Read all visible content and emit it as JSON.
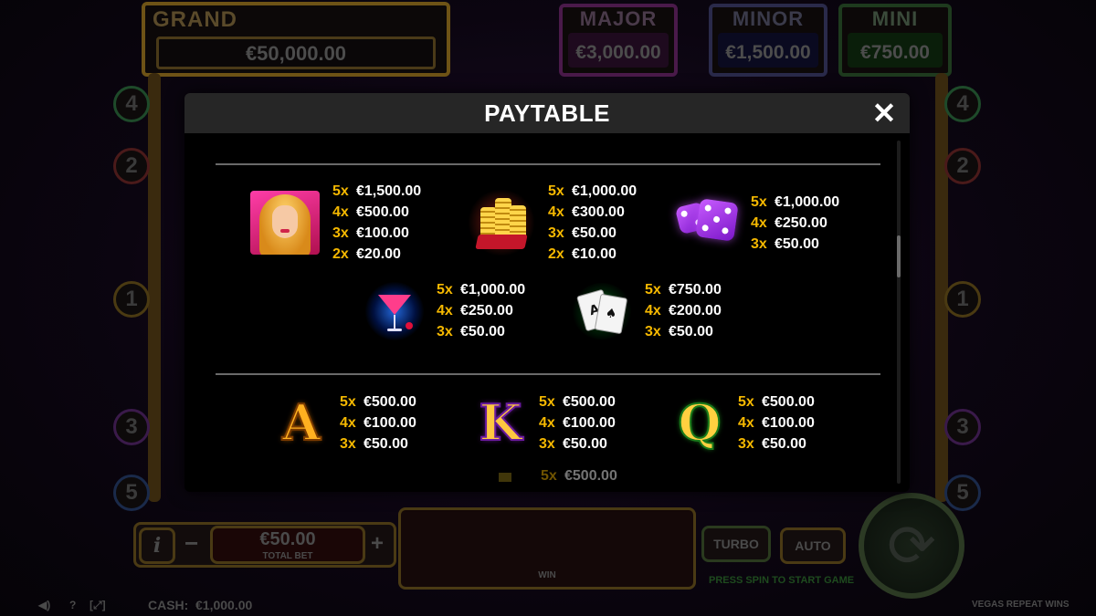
{
  "background": {
    "jackpots": {
      "grand": {
        "label": "GRAND",
        "value": "€50,000.00"
      },
      "major": {
        "label": "MAJOR",
        "value": "€3,000.00"
      },
      "minor": {
        "label": "MINOR",
        "value": "€1,500.00"
      },
      "mini": {
        "label": "MINI",
        "value": "€750.00"
      }
    },
    "line_numbers_left": [
      "4",
      "2",
      "1",
      "3",
      "5"
    ],
    "line_numbers_right": [
      "4",
      "2",
      "1",
      "3",
      "5"
    ],
    "total_bet": {
      "value": "€50.00",
      "label": "TOTAL BET"
    },
    "info_label": "i",
    "minus_label": "−",
    "plus_label": "+",
    "win_label": "WIN",
    "turbo_label": "TURBO",
    "auto_label": "AUTO",
    "prompt": "PRESS SPIN TO START GAME",
    "cash_label": "CASH:",
    "cash_value": "€1,000.00",
    "game_name": "VEGAS REPEAT WINS",
    "question_label": "?"
  },
  "modal": {
    "title": "PAYTABLE",
    "close_icon": "close-icon",
    "premium_symbols": [
      {
        "symbol": "blonde-woman",
        "pays": [
          {
            "mult": "5x",
            "amount": "€1,500.00"
          },
          {
            "mult": "4x",
            "amount": "€500.00"
          },
          {
            "mult": "3x",
            "amount": "€100.00"
          },
          {
            "mult": "2x",
            "amount": "€20.00"
          }
        ]
      },
      {
        "symbol": "gold-coins",
        "pays": [
          {
            "mult": "5x",
            "amount": "€1,000.00"
          },
          {
            "mult": "4x",
            "amount": "€300.00"
          },
          {
            "mult": "3x",
            "amount": "€50.00"
          },
          {
            "mult": "2x",
            "amount": "€10.00"
          }
        ]
      },
      {
        "symbol": "purple-dice",
        "pays": [
          {
            "mult": "5x",
            "amount": "€1,000.00"
          },
          {
            "mult": "4x",
            "amount": "€250.00"
          },
          {
            "mult": "3x",
            "amount": "€50.00"
          }
        ]
      },
      {
        "symbol": "cocktail",
        "pays": [
          {
            "mult": "5x",
            "amount": "€1,000.00"
          },
          {
            "mult": "4x",
            "amount": "€250.00"
          },
          {
            "mult": "3x",
            "amount": "€50.00"
          }
        ]
      },
      {
        "symbol": "playing-cards",
        "pays": [
          {
            "mult": "5x",
            "amount": "€750.00"
          },
          {
            "mult": "4x",
            "amount": "€200.00"
          },
          {
            "mult": "3x",
            "amount": "€50.00"
          }
        ]
      }
    ],
    "royal_symbols": [
      {
        "symbol": "A",
        "pays": [
          {
            "mult": "5x",
            "amount": "€500.00"
          },
          {
            "mult": "4x",
            "amount": "€100.00"
          },
          {
            "mult": "3x",
            "amount": "€50.00"
          }
        ]
      },
      {
        "symbol": "K",
        "pays": [
          {
            "mult": "5x",
            "amount": "€500.00"
          },
          {
            "mult": "4x",
            "amount": "€100.00"
          },
          {
            "mult": "3x",
            "amount": "€50.00"
          }
        ]
      },
      {
        "symbol": "Q",
        "pays": [
          {
            "mult": "5x",
            "amount": "€500.00"
          },
          {
            "mult": "4x",
            "amount": "€100.00"
          },
          {
            "mult": "3x",
            "amount": "€50.00"
          }
        ]
      }
    ],
    "partial_row": {
      "mult": "5x",
      "amount": "€500.00"
    },
    "colors": {
      "multiplier": "#f5b800",
      "amount": "#ffffff",
      "header_bg": "#262626"
    }
  }
}
